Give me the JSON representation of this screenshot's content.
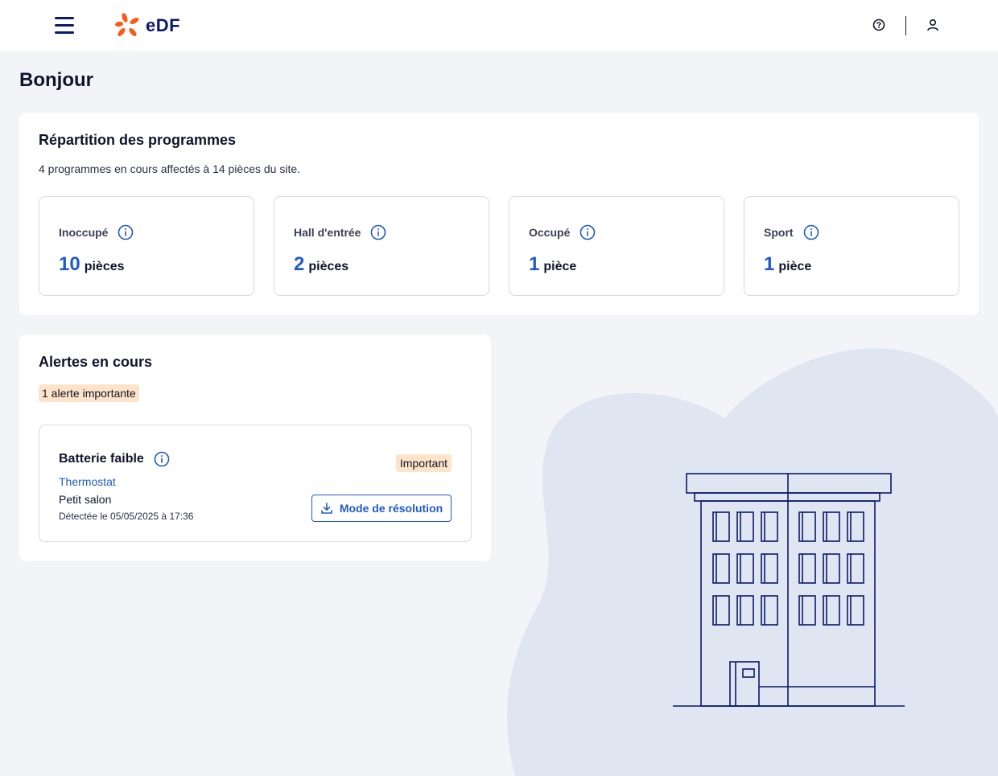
{
  "header": {
    "logo_text": "eDF",
    "icons": {
      "menu": "menu-icon",
      "help": "help-circle-icon",
      "user": "user-icon"
    }
  },
  "greeting": "Bonjour",
  "programs": {
    "title": "Répartition des programmes",
    "subtitle": "4 programmes en cours affectés à 14 pièces du site.",
    "tiles": [
      {
        "label": "Inoccupé",
        "count": "10",
        "unit": "pièces"
      },
      {
        "label": "Hall d'entrée",
        "count": "2",
        "unit": "pièces"
      },
      {
        "label": "Occupé",
        "count": "1",
        "unit": "pièce"
      },
      {
        "label": "Sport",
        "count": "1",
        "unit": "pièce"
      }
    ]
  },
  "alerts": {
    "title": "Alertes en cours",
    "summary_badge": "1 alerte importante",
    "items": [
      {
        "name": "Batterie faible",
        "device": "Thermostat",
        "room": "Petit salon",
        "detected": "Détectée le 05/05/2025 à 17:36",
        "severity": "Important",
        "action_label": "Mode de résolution"
      }
    ]
  },
  "colors": {
    "brand_navy": "#0a1a6b",
    "brand_orange": "#fe5815",
    "accent_blue": "#1f5bc6",
    "badge_bg": "#fde3c8",
    "page_bg": "#f2f4f8",
    "blob": "#dfe5f1"
  }
}
